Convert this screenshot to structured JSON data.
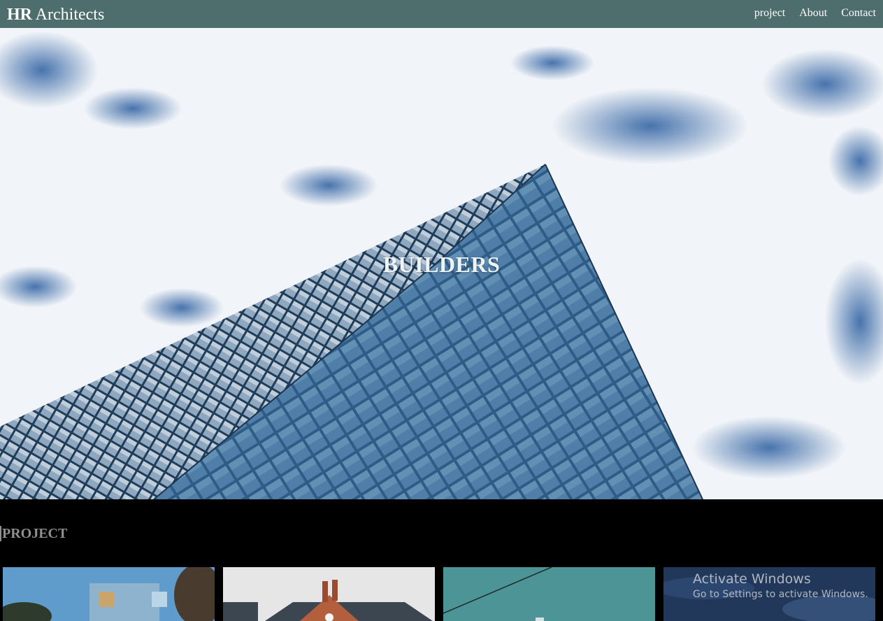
{
  "header": {
    "brand_bold": "HR",
    "brand_rest": " Architects",
    "nav": [
      "project",
      "About",
      "Contact"
    ]
  },
  "hero": {
    "title": "BUILDERS"
  },
  "projects": {
    "heading": "PROJECT"
  },
  "os_overlay": {
    "title": "Activate Windows",
    "subtitle": "Go to Settings to activate Windows."
  },
  "colors": {
    "nav_bg": "#4e6d6d",
    "page_bg": "#000000",
    "heading_gray": "#8f8f8f"
  }
}
